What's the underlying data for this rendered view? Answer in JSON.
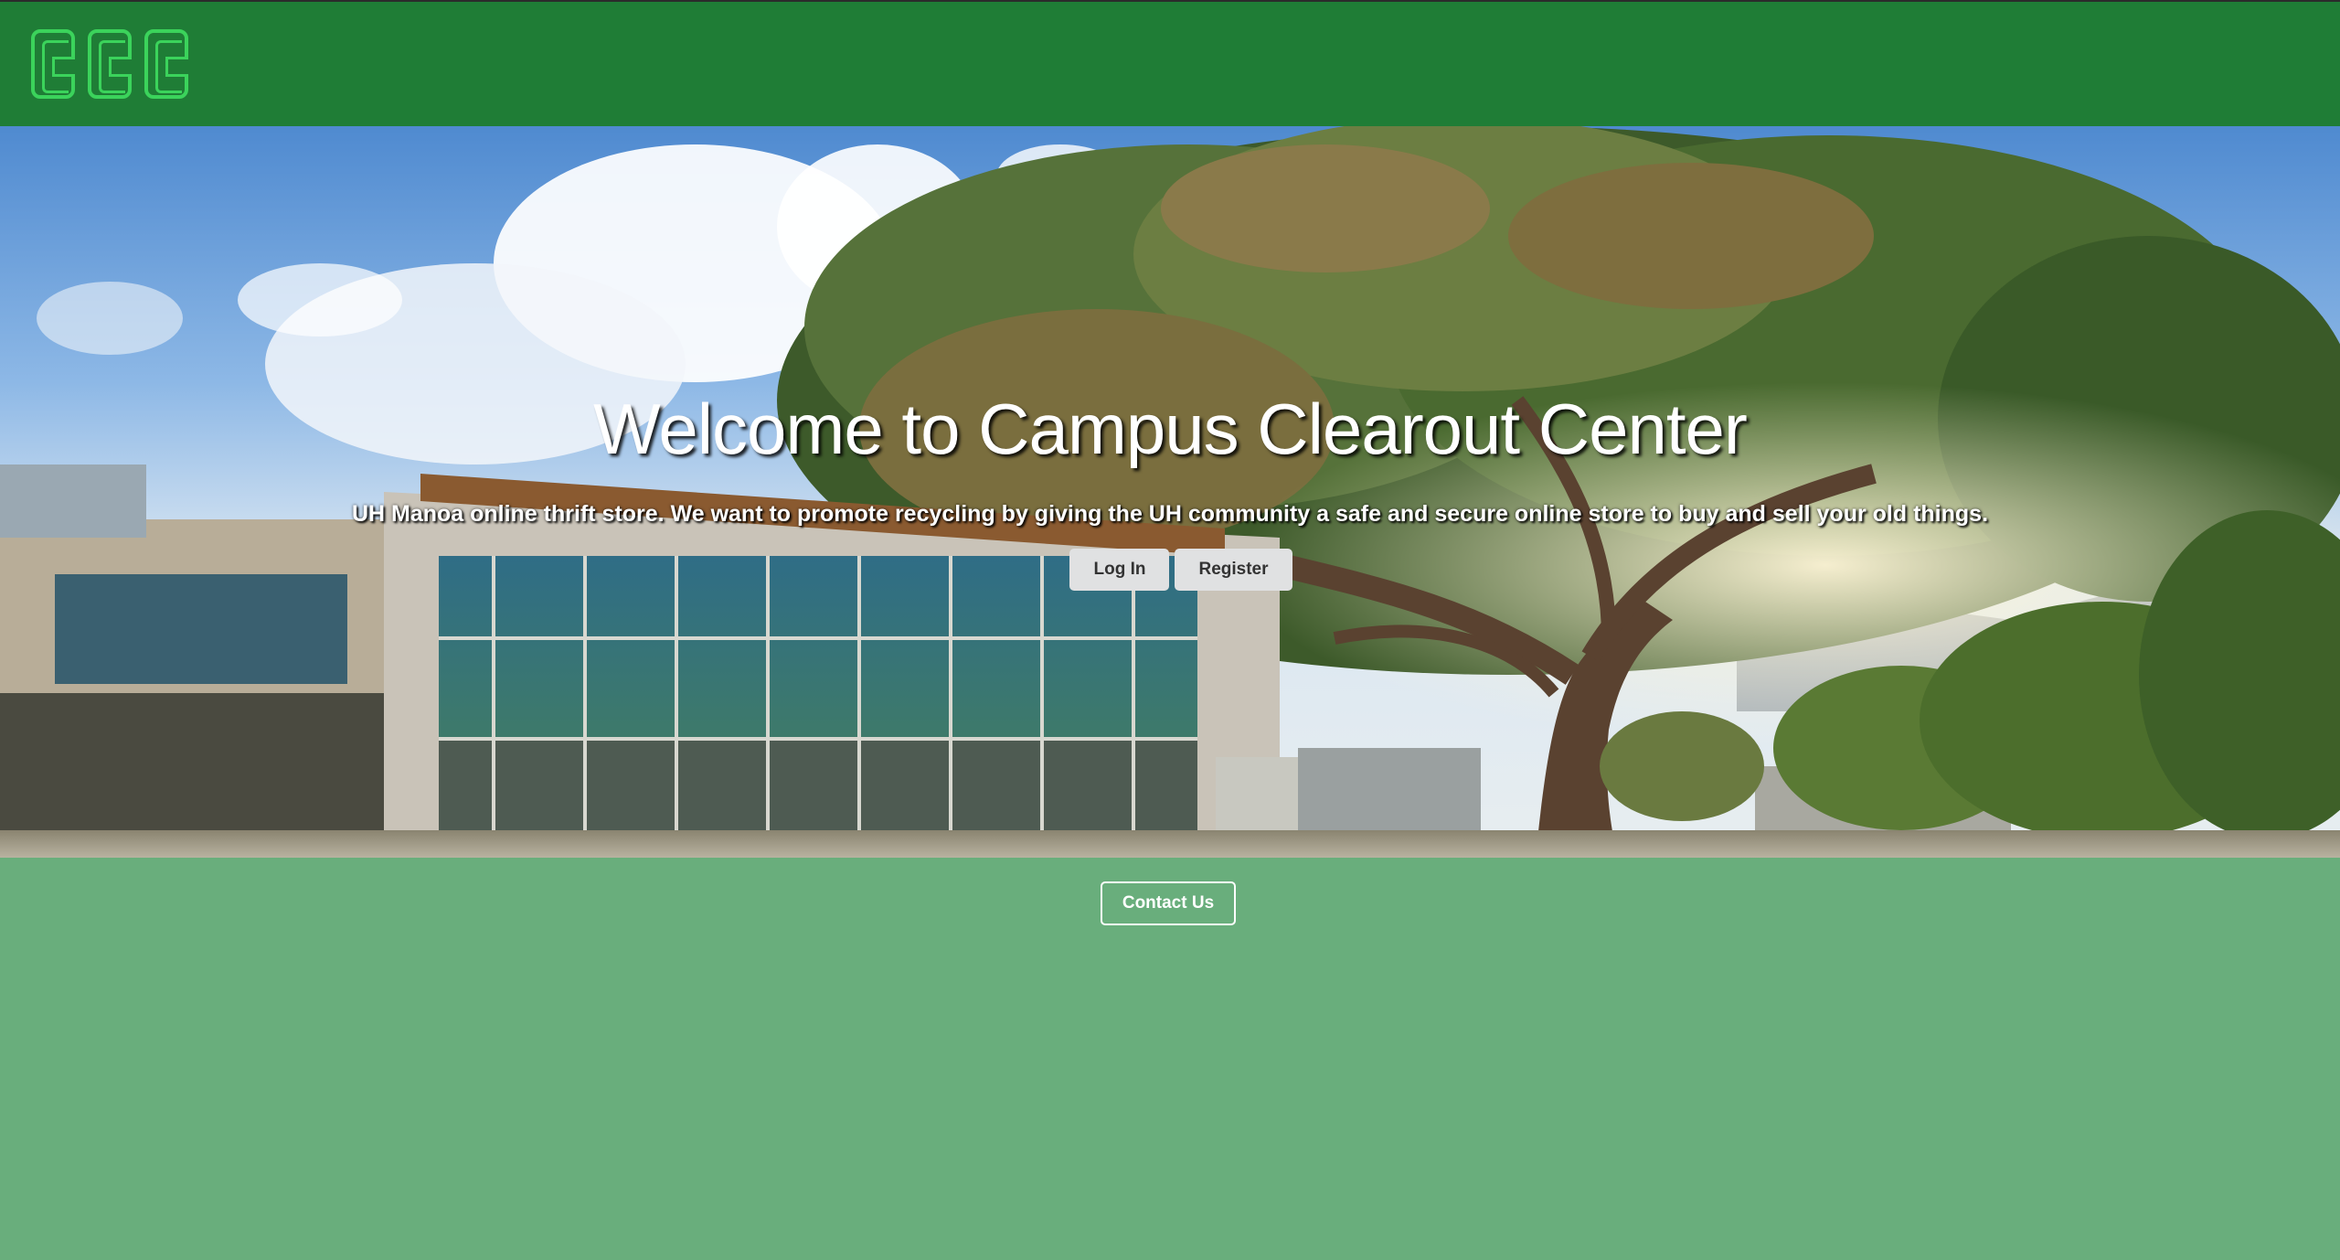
{
  "header": {
    "logo_text": "CCC"
  },
  "hero": {
    "title": "Welcome to Campus Clearout Center",
    "subtitle": "UH Manoa online thrift store. We want to promote recycling by giving the UH community a safe and secure online store to buy and sell your old things.",
    "login_label": "Log In",
    "register_label": "Register"
  },
  "footer": {
    "contact_label": "Contact Us"
  },
  "colors": {
    "header_bg": "#1f7d36",
    "logo_green": "#3bd35b",
    "page_bg": "#69ae7c",
    "button_bg": "#e0e1e2"
  }
}
